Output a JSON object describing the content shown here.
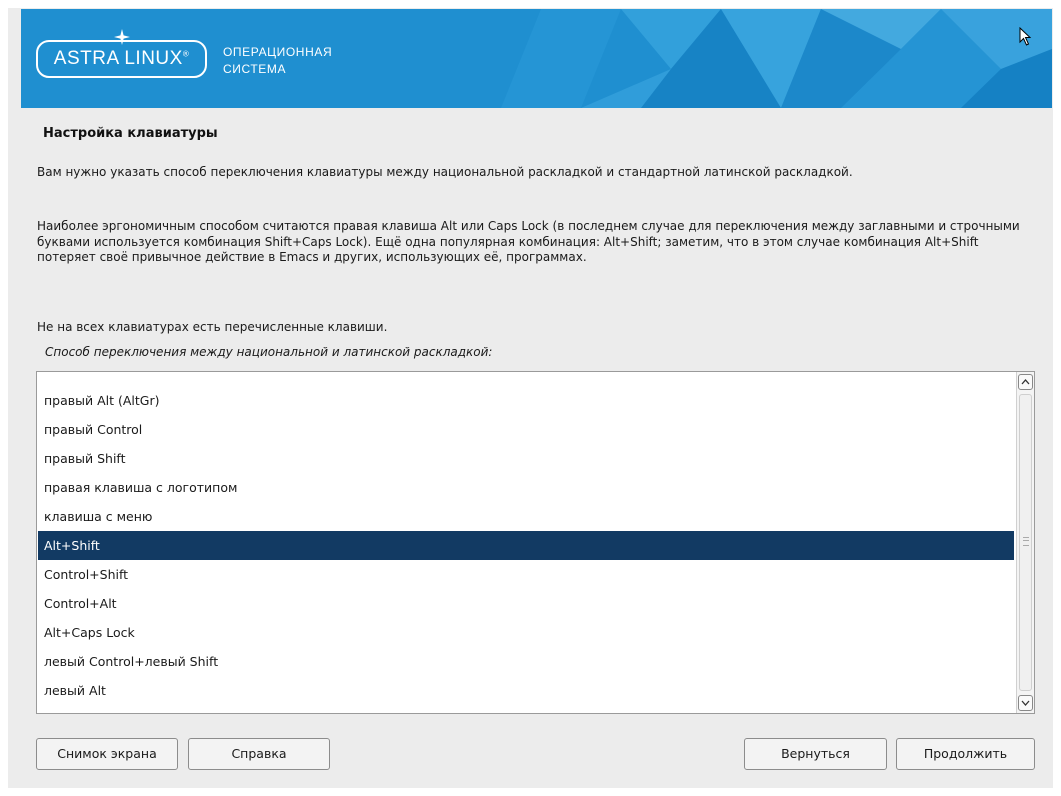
{
  "banner": {
    "logo_text": "ASTRA LINUX",
    "logo_trademark": "®",
    "subtitle_line1": "ОПЕРАЦИОННАЯ",
    "subtitle_line2": "СИСТЕМА",
    "background_color": "#1f8fd0"
  },
  "page": {
    "title": "Настройка клавиатуры",
    "paragraph1": "Вам нужно указать способ переключения клавиатуры между национальной раскладкой и стандартной латинской раскладкой.",
    "paragraph2": "Наиболее эргономичным способом считаются правая клавиша Alt или Caps Lock (в последнем случае для переключения между заглавными и строчными буквами используется комбинация Shift+Caps Lock). Ещё одна популярная комбинация: Alt+Shift; заметим, что в этом случае комбинация Alt+Shift потеряет своё привычное действие в Emacs и других, использующих её, программах.",
    "paragraph3": "Не на всех клавиатурах есть перечисленные клавиши.",
    "prompt": "Способ переключения между национальной и латинской раскладкой:"
  },
  "list": {
    "items": [
      "правый Alt (AltGr)",
      "правый Control",
      "правый Shift",
      "правая клавиша с логотипом",
      "клавиша с меню",
      "Alt+Shift",
      "Control+Shift",
      "Control+Alt",
      "Alt+Caps Lock",
      "левый Control+левый Shift",
      "левый Alt"
    ],
    "selected": "Alt+Shift",
    "selection_color": "#123a63"
  },
  "buttons": {
    "screenshot": "Снимок экрана",
    "help": "Справка",
    "back": "Вернуться",
    "continue": "Продолжить"
  },
  "icons": {
    "logo": "star-icon",
    "cursor": "mouse-pointer-icon",
    "scroll_up": "chevron-up-icon",
    "scroll_down": "chevron-down-icon"
  }
}
